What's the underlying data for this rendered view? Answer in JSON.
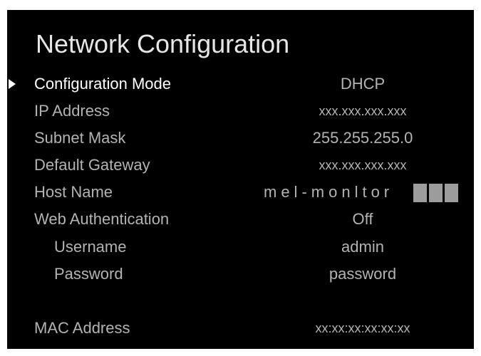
{
  "title": "Network Configuration",
  "rows": [
    {
      "label": "Configuration Mode",
      "value": "DHCP"
    },
    {
      "label": "IP Address",
      "value": "xxx.xxx.xxx.xxx"
    },
    {
      "label": "Subnet Mask",
      "value": "255.255.255.0"
    },
    {
      "label": "Default Gateway",
      "value": "xxx.xxx.xxx.xxx"
    },
    {
      "label": "Host Name",
      "value": "mel-monltor"
    },
    {
      "label": "Web Authentication",
      "value": "Off"
    },
    {
      "label": "Username",
      "value": "admin"
    },
    {
      "label": "Password",
      "value": "password"
    },
    {
      "label": "MAC Address",
      "value": "xx:xx:xx:xx:xx:xx"
    }
  ],
  "colors": {
    "background": "#000000",
    "text": "#b3b3b3",
    "selected_text": "#ffffff",
    "cursor_block": "#9c9c9c"
  },
  "icons": {
    "selection": "triangle-pointer-icon"
  }
}
